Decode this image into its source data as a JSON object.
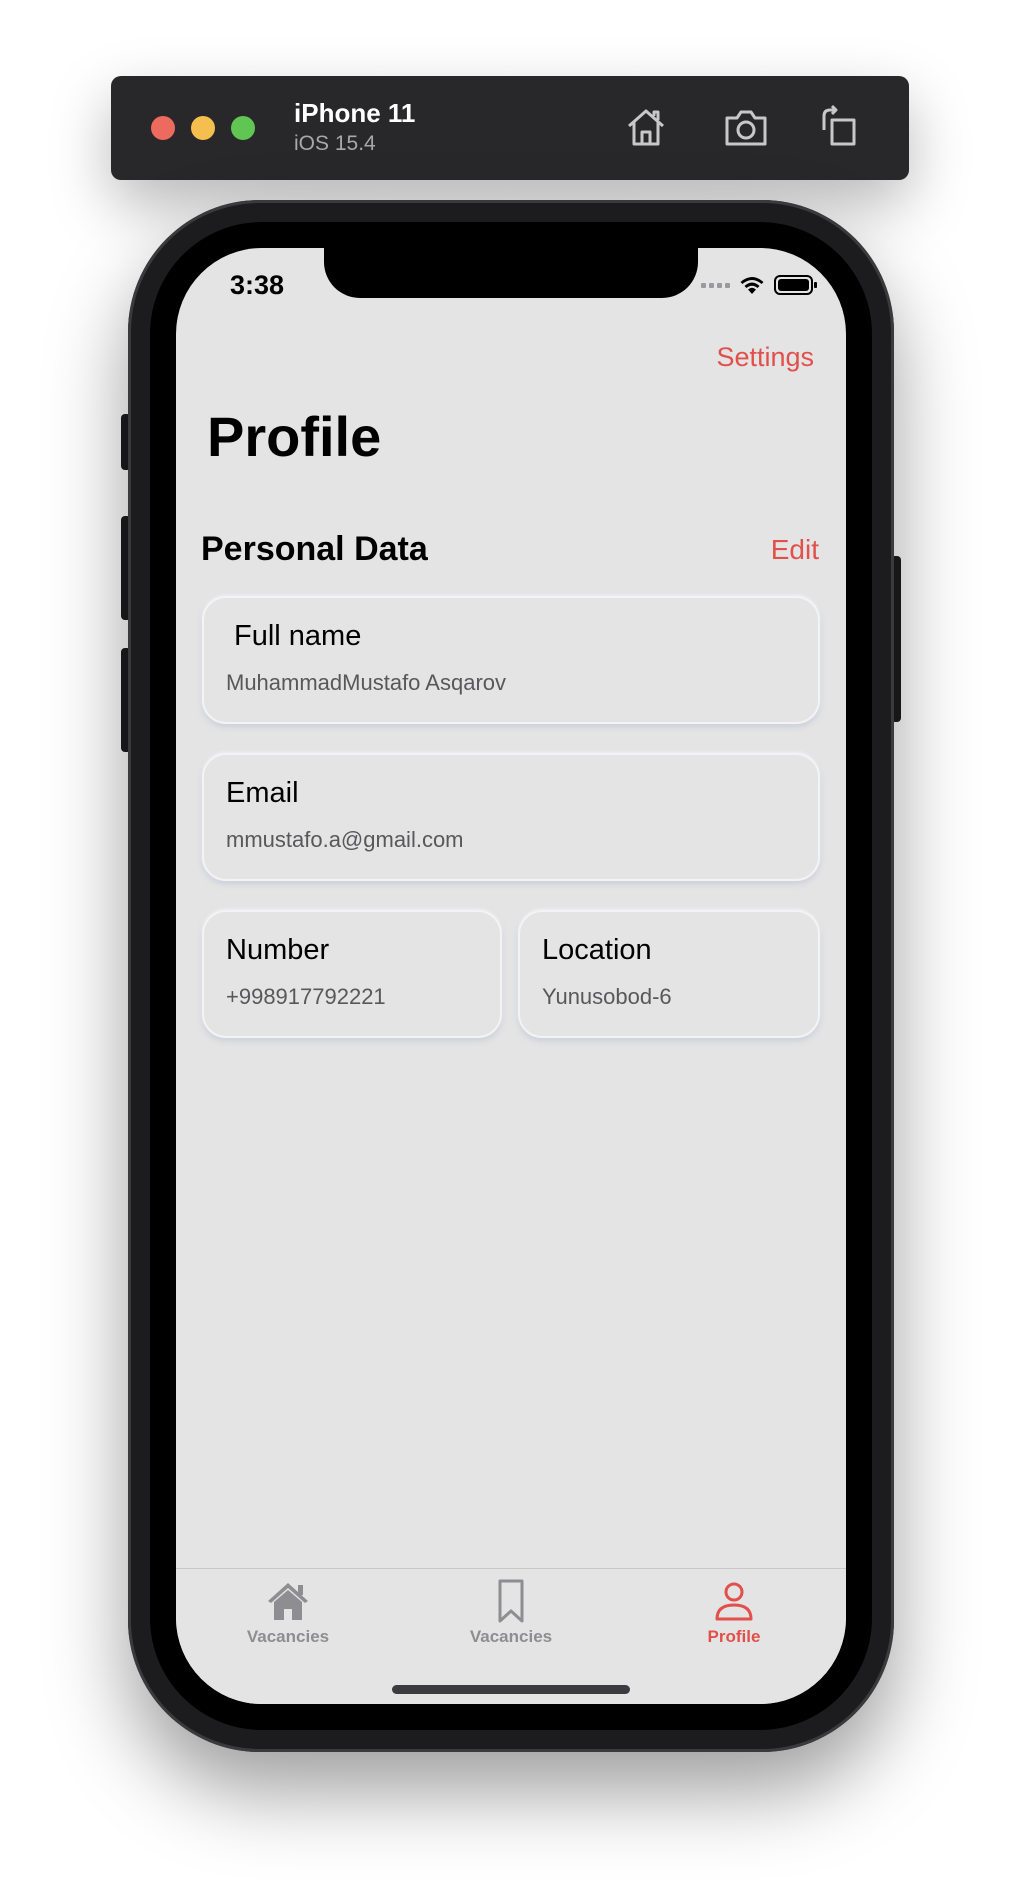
{
  "simulator": {
    "device_name": "iPhone 11",
    "os_version": "iOS 15.4",
    "icons": [
      "home-icon",
      "screenshot-icon",
      "rotate-icon"
    ]
  },
  "status_bar": {
    "time": "3:38",
    "icons": [
      "signal-icon",
      "wifi-icon",
      "battery-icon"
    ]
  },
  "nav": {
    "settings_label": "Settings",
    "title": "Profile"
  },
  "personal_data": {
    "section_title": "Personal Data",
    "edit_label": "Edit",
    "full_name": {
      "label": "Full name",
      "value": "MuhammadMustafo Asqarov"
    },
    "email": {
      "label": "Email",
      "value": "mmustafo.a@gmail.com"
    },
    "number": {
      "label": "Number",
      "value": "+998917792221"
    },
    "location": {
      "label": "Location",
      "value": "Yunusobod-6"
    }
  },
  "tab_bar": {
    "items": [
      {
        "label": "Vacancies",
        "icon": "house-icon",
        "active": false
      },
      {
        "label": "Vacancies",
        "icon": "bookmark-icon",
        "active": false
      },
      {
        "label": "Profile",
        "icon": "person-icon",
        "active": true
      }
    ]
  },
  "colors": {
    "accent": "#e2504c",
    "screen_background": "#e4e4e5",
    "inactive_tab": "#8e8e92"
  }
}
